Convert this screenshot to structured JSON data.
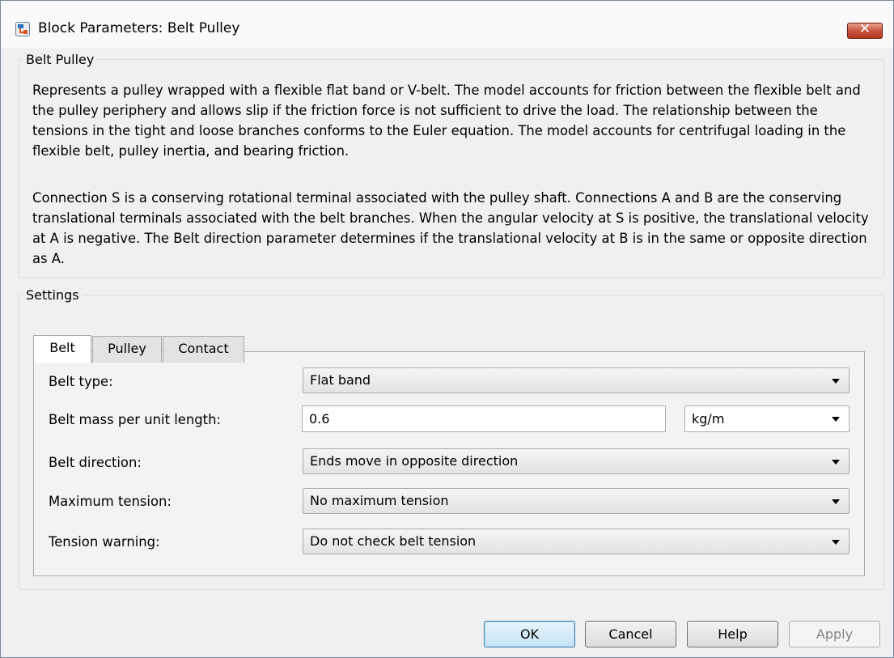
{
  "window": {
    "title": "Block Parameters: Belt Pulley",
    "close_glyph": "✕"
  },
  "block": {
    "group_title": "Belt Pulley",
    "description_p1": "Represents a pulley wrapped with a flexible flat band or V-belt. The model accounts for friction between the flexible belt and the pulley periphery and allows slip if the friction force is not sufficient to drive the load. The relationship between the tensions in the tight and loose branches conforms to the Euler equation. The model accounts for centrifugal loading in the flexible belt, pulley inertia, and bearing friction.",
    "description_p2": "Connection S is a conserving rotational terminal associated with the pulley shaft. Connections A and B are the conserving translational terminals associated with the belt branches. When the angular velocity at S is positive, the translational velocity at A is negative. The Belt direction parameter determines if the translational velocity at B is in the same or opposite direction as A."
  },
  "settings": {
    "group_title": "Settings",
    "tabs": [
      {
        "label": "Belt",
        "active": true
      },
      {
        "label": "Pulley",
        "active": false
      },
      {
        "label": "Contact",
        "active": false
      }
    ],
    "params": {
      "belt_type": {
        "label": "Belt type:",
        "value": "Flat band"
      },
      "belt_mass": {
        "label": "Belt mass per unit length:",
        "value": "0.6",
        "unit": "kg/m"
      },
      "belt_direction": {
        "label": "Belt direction:",
        "value": "Ends move in opposite direction"
      },
      "max_tension": {
        "label": "Maximum tension:",
        "value": "No maximum tension"
      },
      "tension_warning": {
        "label": "Tension warning:",
        "value": "Do not check belt tension"
      }
    }
  },
  "buttons": {
    "ok": "OK",
    "cancel": "Cancel",
    "help": "Help",
    "apply": "Apply"
  },
  "colors": {
    "close_button": "#c7503a",
    "default_button_border": "#3c7fb1",
    "dialog_background": "#f0f0f0"
  }
}
